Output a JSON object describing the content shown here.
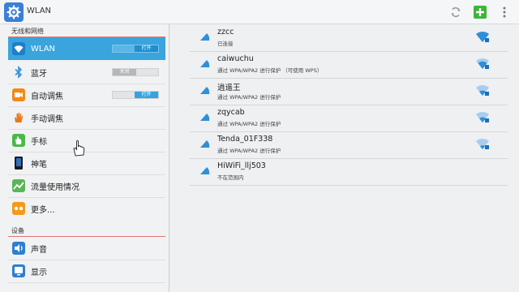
{
  "app": {
    "title": "WLAN"
  },
  "actionbar": {
    "refresh_icon": "refresh-icon",
    "add_icon": "add-network-icon",
    "overflow_icon": "overflow-menu-icon"
  },
  "sidebar": {
    "sections": [
      {
        "title": "无线和网络"
      },
      {
        "title": "设备"
      }
    ],
    "items": [
      {
        "label": "WLAN",
        "icon": "wifi-icon",
        "toggle": "打开",
        "toggle_state": "on",
        "selected": true
      },
      {
        "label": "蓝牙",
        "icon": "bluetooth-icon",
        "toggle": "关闭",
        "toggle_state": "off"
      },
      {
        "label": "自动调焦",
        "icon": "camera-icon",
        "toggle": "打开",
        "toggle_state": "on"
      },
      {
        "label": "手动调焦",
        "icon": "hand-icon"
      },
      {
        "label": "手标",
        "icon": "glove-icon"
      },
      {
        "label": "神笔",
        "icon": "pen-icon"
      },
      {
        "label": "流量使用情况",
        "icon": "data-usage-icon"
      },
      {
        "label": "更多...",
        "icon": "more-icon"
      },
      {
        "label": "声音",
        "icon": "sound-icon"
      },
      {
        "label": "显示",
        "icon": "display-icon"
      }
    ]
  },
  "networks": [
    {
      "ssid": "zzcc",
      "status": "已连接",
      "in_range": true
    },
    {
      "ssid": "caiwuchu",
      "status": "通过 WPA/WPA2 进行保护 （可使用 WPS）",
      "in_range": true
    },
    {
      "ssid": "逍遥王",
      "status": "通过 WPA/WPA2 进行保护",
      "in_range": true
    },
    {
      "ssid": "zqycab",
      "status": "通过 WPA/WPA2 进行保护",
      "in_range": true
    },
    {
      "ssid": "Tenda_01F338",
      "status": "通过 WPA/WPA2 进行保护",
      "in_range": true
    },
    {
      "ssid": "HiWiFi_llj503",
      "status": "不在范围内",
      "in_range": false
    }
  ],
  "colors": {
    "accent": "#3aa4dc",
    "section_line": "#e0776f",
    "wifi_blue": "#2f8fd8",
    "add_green": "#3db53a"
  }
}
